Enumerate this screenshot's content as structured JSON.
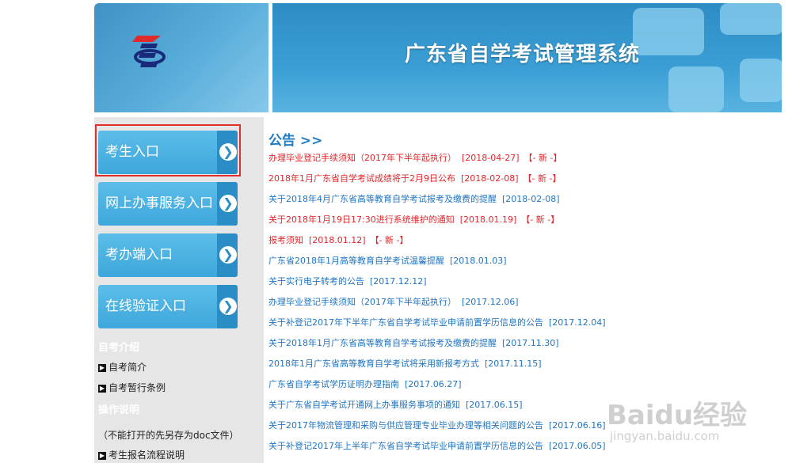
{
  "header": {
    "title": "广东省自学考试管理系统"
  },
  "sidebar": {
    "entries": [
      {
        "label": "考生入口"
      },
      {
        "label": "网上办事服务入口"
      },
      {
        "label": "考办端入口"
      },
      {
        "label": "在线验证入口"
      }
    ],
    "sections": [
      {
        "title": "自考介绍",
        "links": [
          "自考简介",
          "自考暂行条例"
        ]
      },
      {
        "title": "操作说明",
        "note": "（不能打开的先另存为doc文件）",
        "links": [
          "考生报名流程说明"
        ]
      }
    ]
  },
  "notices": {
    "title": "公告 >>",
    "items": [
      {
        "text": "办理毕业登记手续须知（2017年下半年起执行）",
        "date": "[2018-04-27]",
        "badge": "【- 新 -】",
        "color": "red"
      },
      {
        "text": "2018年1月广东省自学考试成绩将于2月9日公布",
        "date": "[2018-02-08]",
        "badge": "【- 新 -】",
        "color": "red"
      },
      {
        "text": "关于2018年4月广东省高等教育自学考试报考及缴费的提醒",
        "date": "[2018-02-08]",
        "badge": "",
        "color": "blue"
      },
      {
        "text": "关于2018年1月19日17:30进行系统维护的通知",
        "date": "[2018.01.19]",
        "badge": "【- 新 -】",
        "color": "red"
      },
      {
        "text": "报考须知",
        "date": "[2018.01.12]",
        "badge": "【- 新 -】",
        "color": "red"
      },
      {
        "text": "广东省2018年1月高等教育自学考试温馨提醒",
        "date": "[2018.01.03]",
        "badge": "",
        "color": "blue"
      },
      {
        "text": "关于实行电子转考的公告",
        "date": "[2017.12.12]",
        "badge": "",
        "color": "blue"
      },
      {
        "text": "办理毕业登记手续须知（2017年下半年起执行）",
        "date": "[2017.12.06]",
        "badge": "",
        "color": "blue"
      },
      {
        "text": "关于补登记2017年下半年广东省自学考试毕业申请前置学历信息的公告",
        "date": "[2017.12.04]",
        "badge": "",
        "color": "blue"
      },
      {
        "text": "关于2018年1月广东省高等教育自学考试报考及缴费的提醒",
        "date": "[2017.11.30]",
        "badge": "",
        "color": "blue"
      },
      {
        "text": "2018年1月广东省高等教育自学考试将采用新报考方式",
        "date": "[2017.11.15]",
        "badge": "",
        "color": "blue"
      },
      {
        "text": "广东省自学考试学历证明办理指南",
        "date": "[2017.06.27]",
        "badge": "",
        "color": "blue"
      },
      {
        "text": "关于广东省自学考试开通网上办事服务事项的通知",
        "date": "[2017.06.15]",
        "badge": "",
        "color": "blue"
      },
      {
        "text": "关于2017年物流管理和采购与供应管理专业毕业办理等相关问题的公告",
        "date": "[2017.06.16]",
        "badge": "",
        "color": "blue"
      },
      {
        "text": "关于补登记2017年上半年广东省自学考试毕业申请前置学历信息的公告",
        "date": "[2017.06.05]",
        "badge": "",
        "color": "blue"
      }
    ]
  },
  "watermark": {
    "brand": "Baidu经验",
    "url": "jingyan.baidu.com"
  }
}
